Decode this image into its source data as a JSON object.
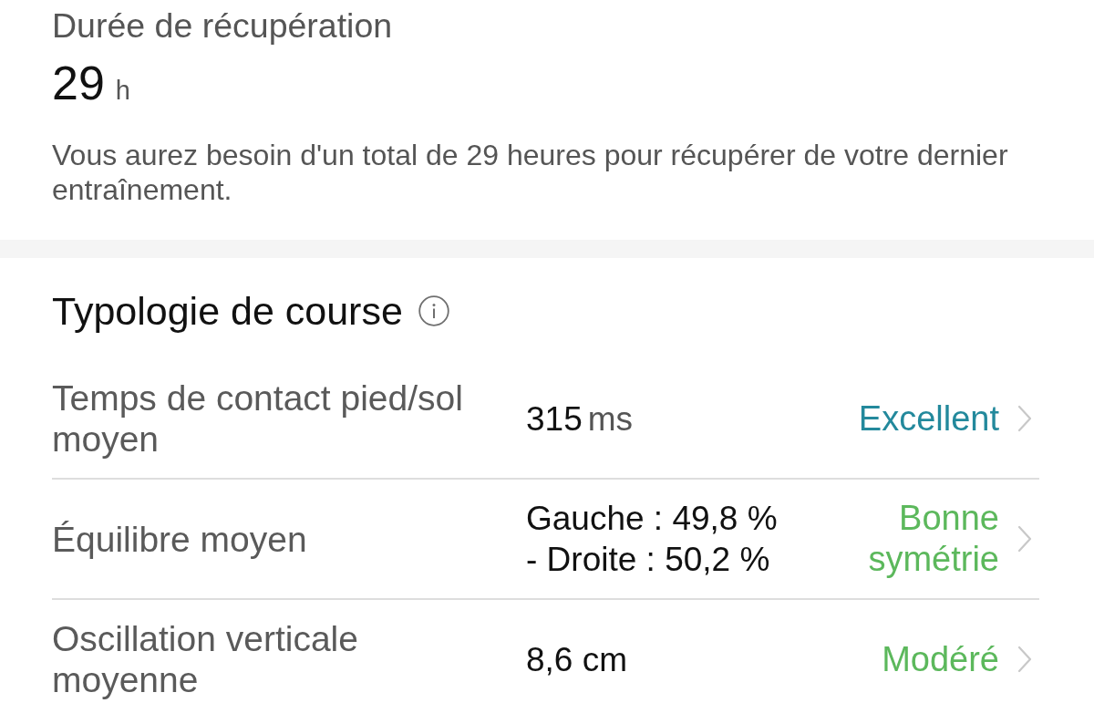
{
  "recovery": {
    "title": "Durée de récupération",
    "value": "29",
    "unit": "h",
    "description": "Vous aurez besoin d'un total de 29 heures pour récupérer de votre dernier entraînement."
  },
  "running_form": {
    "title": "Typologie de course",
    "metrics": [
      {
        "label": "Temps de contact pied/sol moyen",
        "value_lines": [
          "315"
        ],
        "unit": "ms",
        "rating": "Excellent",
        "color": "#23899c"
      },
      {
        "label": "Équilibre moyen",
        "value_lines": [
          "Gauche : 49,8 %",
          "- Droite : 50,2 %"
        ],
        "rating": "Bonne symétrie",
        "color": "#5cb85c"
      },
      {
        "label": "Oscillation verticale moyenne",
        "value_lines": [
          "8,6 cm"
        ],
        "rating": "Modéré",
        "color": "#5cb85c"
      }
    ]
  }
}
